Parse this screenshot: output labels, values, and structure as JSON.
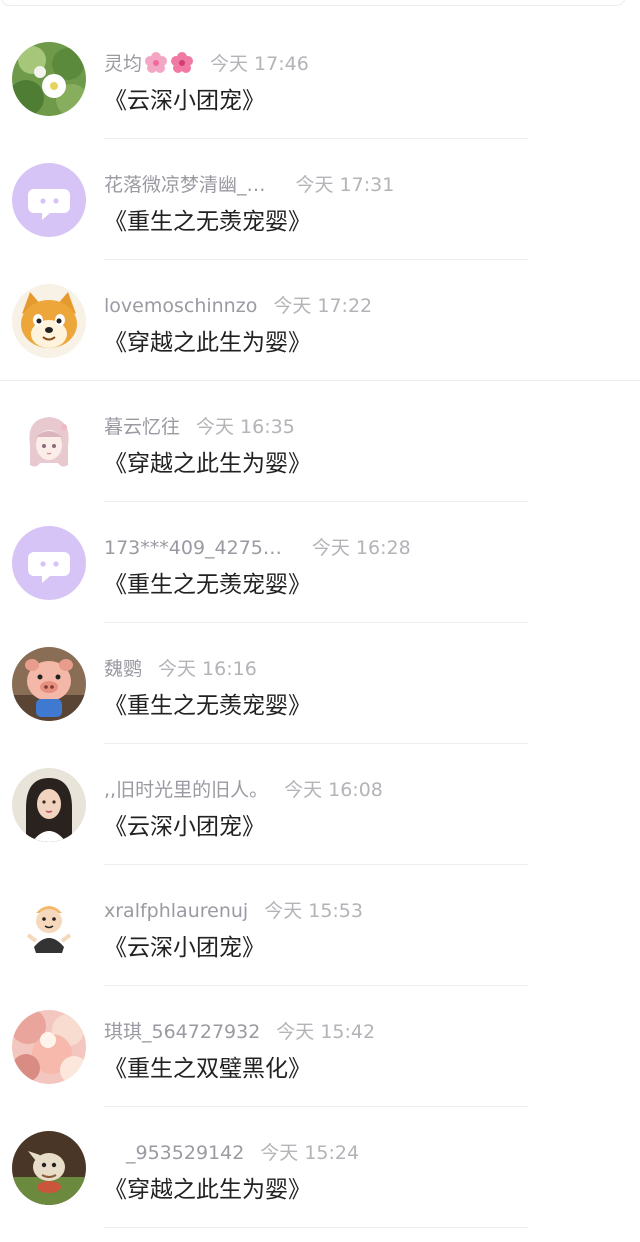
{
  "comments": [
    {
      "username": "灵均",
      "time": "今天 17:46",
      "book": "《云深小团宠》",
      "avatar_icon": "nature-photo-avatar-icon"
    },
    {
      "username": "花落微凉梦清幽_…",
      "time": "今天 17:31",
      "book": "《重生之无羡宠婴》",
      "avatar_icon": "default-chat-avatar-icon"
    },
    {
      "username": "lovemoschinnzo",
      "time": "今天 17:22",
      "book": "《穿越之此生为婴》",
      "avatar_icon": "shiba-dog-avatar-icon"
    },
    {
      "username": "暮云忆往",
      "time": "今天 16:35",
      "book": "《穿越之此生为婴》",
      "avatar_icon": "anime-girl-avatar-icon"
    },
    {
      "username": "173***409_4275…",
      "time": "今天 16:28",
      "book": "《重生之无羡宠婴》",
      "avatar_icon": "default-chat-avatar-icon"
    },
    {
      "username": "魏鹦",
      "time": "今天 16:16",
      "book": "《重生之无羡宠婴》",
      "avatar_icon": "pig-toy-avatar-icon"
    },
    {
      "username": ",,旧时光里的旧人。",
      "time": "今天 16:08",
      "book": "《云深小团宠》",
      "avatar_icon": "portrait-photo-avatar-icon"
    },
    {
      "username": "xralfphlaurenuj",
      "time": "今天 15:53",
      "book": "《云深小团宠》",
      "avatar_icon": "cartoon-sticker-avatar-icon"
    },
    {
      "username": "琪琪_564727932",
      "time": "今天 15:42",
      "book": "《重生之双璧黑化》",
      "avatar_icon": "blossom-photo-avatar-icon"
    },
    {
      "username": "_953529142",
      "time": "今天 15:24",
      "book": "《穿越之此生为婴》",
      "avatar_icon": "game-character-avatar-icon"
    }
  ],
  "colors": {
    "username": "#9a9aa2",
    "time": "#b3b3b8",
    "book_title": "#222222",
    "default_avatar_bg": "#d7c4f7",
    "divider": "#efeff2"
  }
}
